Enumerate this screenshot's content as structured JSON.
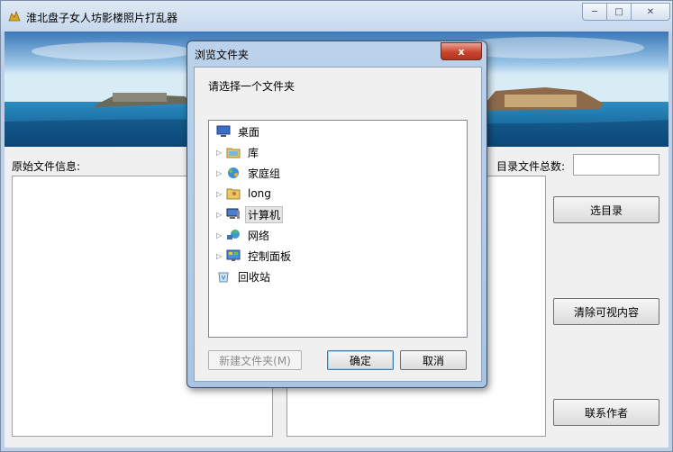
{
  "window": {
    "title": "淮北盘子女人坊影楼照片打乱器",
    "icon": "app-icon"
  },
  "labels": {
    "original_info": "原始文件信息:",
    "dir_total": "目录文件总数:"
  },
  "fields": {
    "dir_total_value": ""
  },
  "buttons": {
    "select_dir": "选目录",
    "clear": "清除可视内容",
    "contact": "联系作者"
  },
  "dialog": {
    "title": "浏览文件夹",
    "close_label": "x",
    "prompt": "请选择一个文件夹",
    "tree": [
      {
        "label": "桌面",
        "icon": "desktop-icon",
        "expandable": false
      },
      {
        "label": "库",
        "icon": "library-icon",
        "expandable": true
      },
      {
        "label": "家庭组",
        "icon": "homegroup-icon",
        "expandable": true
      },
      {
        "label": "long",
        "icon": "user-folder-icon",
        "expandable": true
      },
      {
        "label": "计算机",
        "icon": "computer-icon",
        "expandable": true,
        "selected": true
      },
      {
        "label": "网络",
        "icon": "network-icon",
        "expandable": true
      },
      {
        "label": "控制面板",
        "icon": "control-panel-icon",
        "expandable": true
      },
      {
        "label": "回收站",
        "icon": "recycle-bin-icon",
        "expandable": false
      }
    ],
    "buttons": {
      "new_folder": "新建文件夹(M)",
      "ok": "确定",
      "cancel": "取消"
    }
  }
}
